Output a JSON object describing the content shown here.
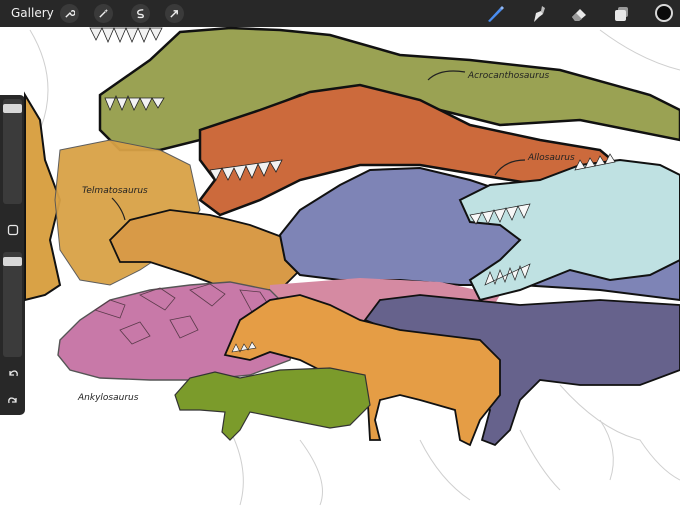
{
  "toolbar": {
    "gallery_label": "Gallery",
    "left_tools": [
      "wrench-icon",
      "magic-wand-icon",
      "selection-icon",
      "transform-arrow-icon"
    ],
    "right_tools": [
      "brush-icon",
      "smudge-icon",
      "eraser-icon",
      "layers-icon"
    ],
    "active_tool": "brush-icon",
    "active_color": "#0a0a0a",
    "accent": "#4a8df0"
  },
  "sidebar": {
    "brush_size_level": 0.95,
    "opacity_level": 0.95,
    "buttons": [
      "modify-square-icon",
      "undo-icon",
      "redo-icon"
    ]
  },
  "canvas": {
    "labels": {
      "acrocanthosaurus": "Acrocanthosaurus",
      "allosaurus": "Allosaurus",
      "telmatosaurus": "Telmatosaurus",
      "ankylosaurus": "Ankylosaurus"
    },
    "colors": {
      "acrocanthosaurus": "#9aa253",
      "allosaurus": "#cc6a3c",
      "telmatosaurus": "#d89a47",
      "ceratopsian": "#d9a246",
      "blue_theropod": "#7e84b6",
      "spinosaur": "#bfe1e2",
      "ankylosaur": "#c879a8",
      "compsognathid": "#e59d45",
      "small_green": "#7b9b2b",
      "raptor": "#66628c",
      "pink_bg": "#d58aa2"
    }
  }
}
